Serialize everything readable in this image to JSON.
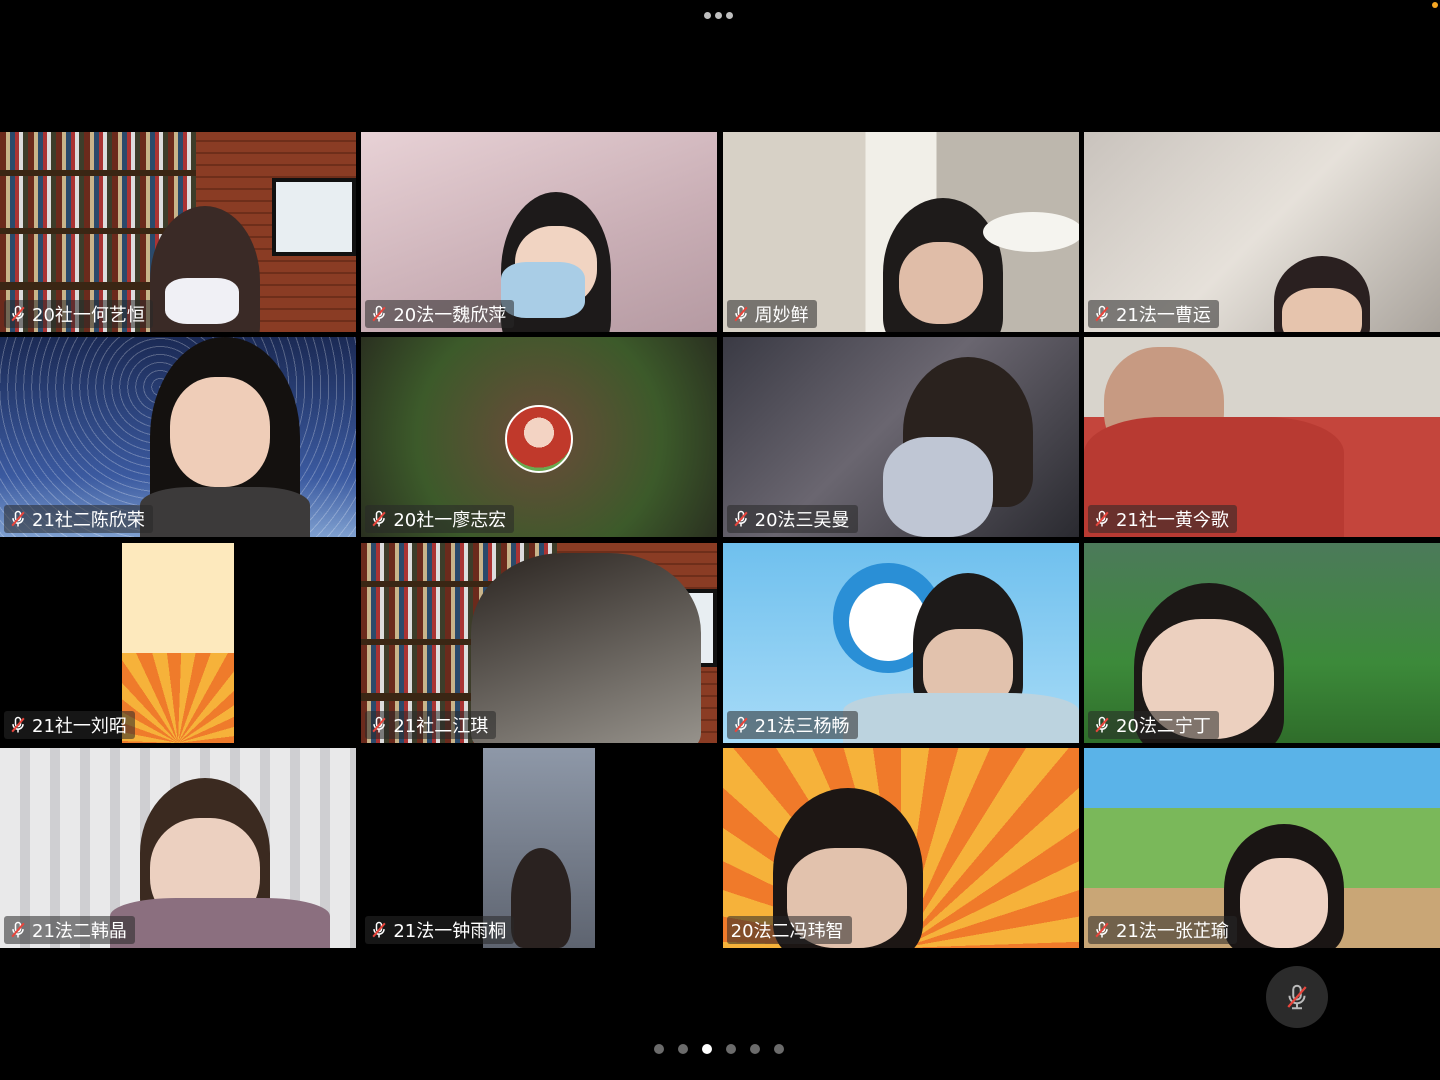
{
  "window": {
    "top_menu_icon": "more-dots-icon"
  },
  "participants": [
    {
      "name": "20社一何艺恒",
      "muted": true
    },
    {
      "name": "20法一魏欣萍",
      "muted": true
    },
    {
      "name": "周妙鲜",
      "muted": true
    },
    {
      "name": "21法一曹运",
      "muted": true
    },
    {
      "name": "21社二陈欣荣",
      "muted": true
    },
    {
      "name": "20社一廖志宏",
      "muted": true
    },
    {
      "name": "20法三吴曼",
      "muted": true
    },
    {
      "name": "21社一黄今歌",
      "muted": true
    },
    {
      "name": "21社一刘昭",
      "muted": true
    },
    {
      "name": "21社二江琪",
      "muted": true
    },
    {
      "name": "21法三杨畅",
      "muted": true
    },
    {
      "name": "20法二宁丁",
      "muted": true
    },
    {
      "name": "21法二韩晶",
      "muted": true
    },
    {
      "name": "21法一钟雨桐",
      "muted": true
    },
    {
      "name": "20法二冯玮智",
      "muted": false
    },
    {
      "name": "21法一张芷瑜",
      "muted": true
    }
  ],
  "controls": {
    "mic_button_icon": "mic-muted-icon",
    "mic_state": "muted"
  },
  "pagination": {
    "total_pages": 6,
    "current_page": 3
  },
  "colors": {
    "background": "#000000",
    "mute_icon": "#e8453c",
    "page_dot_active": "#ffffff",
    "page_dot_inactive": "#6b6b6b"
  }
}
